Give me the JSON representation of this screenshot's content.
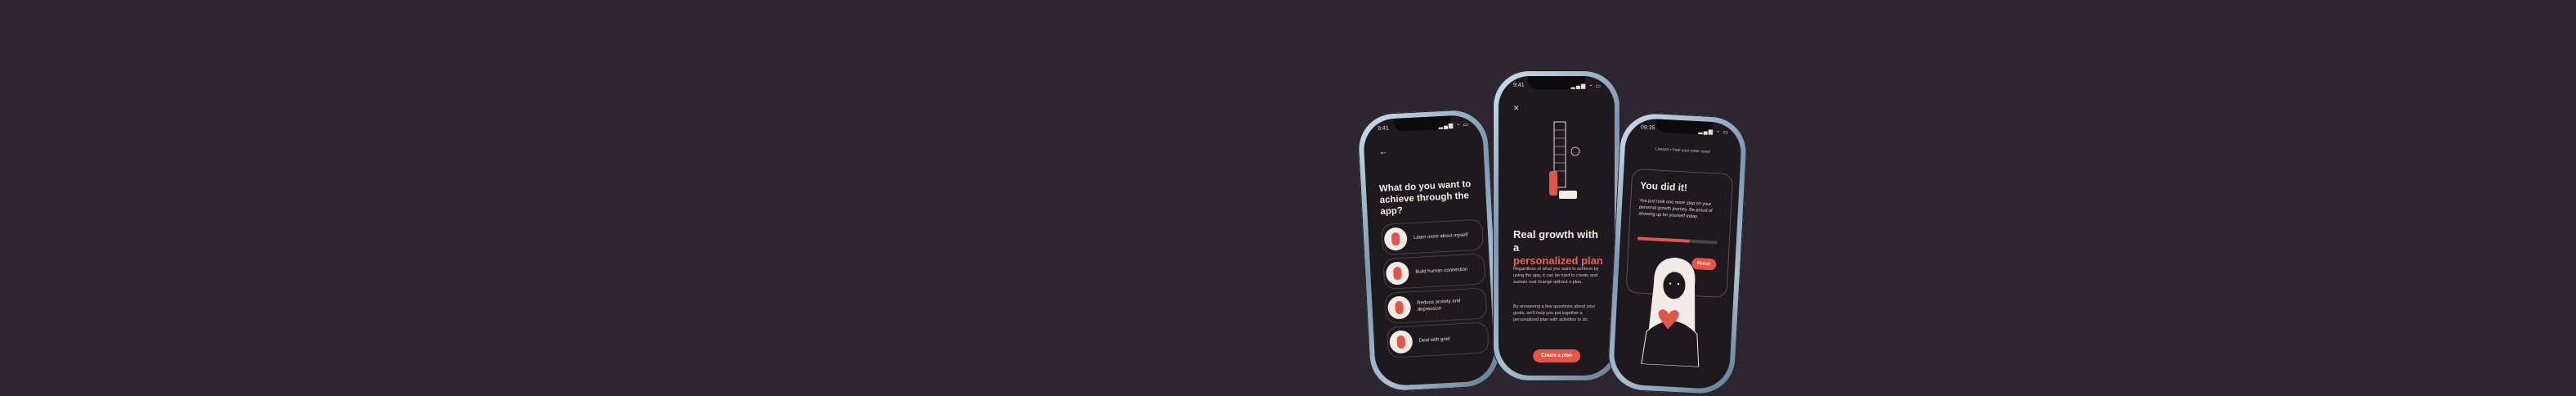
{
  "phones": {
    "left": {
      "time": "9:41",
      "back_icon": "back-arrow-icon",
      "question": "What do you want to achieve through the app?",
      "options": [
        {
          "label": "Learn more about myself"
        },
        {
          "label": "Build human connection"
        },
        {
          "label": "Reduce anxiety and depression"
        },
        {
          "label": "Deal with grief"
        }
      ]
    },
    "center": {
      "time": "9:41",
      "close_icon": "close-icon",
      "title_line1": "Real growth with a",
      "title_line2": "personalized plan",
      "paragraph1": "Regardless of what you want to achieve by using the app, it can be hard to create and sustain real change without a plan.",
      "paragraph2": "By answering a few questions about your goals, we'll help you put together a personalized plan with activities to do.",
      "button_label": "Create a plan"
    },
    "right": {
      "time": "09:35",
      "progress_caption": "Lesson • Feel your inner voice",
      "card_title": "You did it!",
      "card_text": "You just took one more step on your personal growth journey. Be proud of showing up for yourself today.",
      "progress": 0.65,
      "finish_label": "Finish"
    }
  },
  "colors": {
    "background": "#2d2530",
    "screen": "#1d191e",
    "accent": "#e0574a"
  }
}
